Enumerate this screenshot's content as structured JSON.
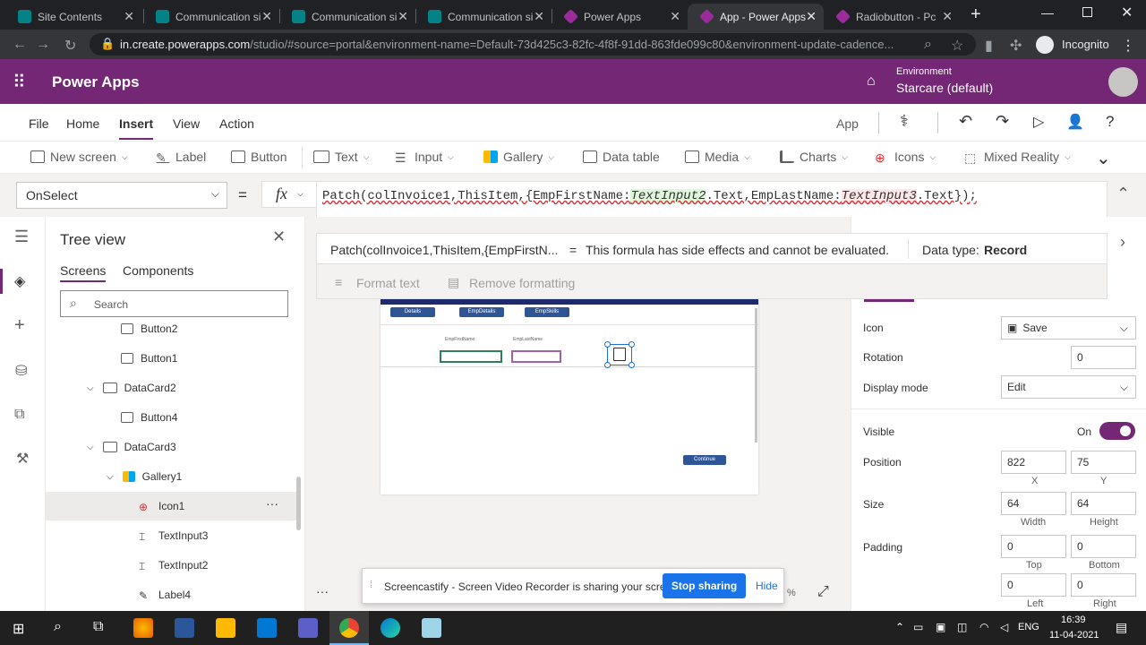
{
  "browser": {
    "tabs": [
      {
        "title": "Site Contents",
        "color": "#038387"
      },
      {
        "title": "Communication si",
        "color": "#038387"
      },
      {
        "title": "Communication si",
        "color": "#038387"
      },
      {
        "title": "Communication si",
        "color": "#038387"
      },
      {
        "title": "Power Apps",
        "color": "#9c2b9c"
      },
      {
        "title": "App - Power Apps",
        "color": "#9c2b9c"
      },
      {
        "title": "Radiobutton - Pc",
        "color": "#9c2b9c"
      }
    ],
    "url_host": "in.create.powerapps.com",
    "url_path": "/studio/#source=portal&environment-name=Default-73d425c3-82fc-4f8f-91dd-863fde099c80&environment-update-cadence...",
    "incognito_label": "Incognito"
  },
  "app": {
    "title": "Power Apps",
    "environment_label": "Environment",
    "environment_name": "Starcare (default)",
    "brand_color": "#742774"
  },
  "menu": {
    "items": [
      "File",
      "Home",
      "Insert",
      "View",
      "Action"
    ],
    "active": "Insert",
    "app_label": "App"
  },
  "ribbon": {
    "items": [
      "New screen",
      "Label",
      "Button",
      "Text",
      "Input",
      "Gallery",
      "Data table",
      "Media",
      "Charts",
      "Icons",
      "Mixed Reality"
    ]
  },
  "formula": {
    "property": "OnSelect",
    "equals": "=",
    "fx": "fx",
    "parts": [
      "Patch(colInvoice1,ThisItem,{EmpFirstName:",
      "TextInput2",
      ".Text,EmpLastName:",
      "TextInput3",
      ".Text});"
    ],
    "preview": "Patch(colInvoice1,ThisItem,{EmpFirstN...",
    "message": "This formula has side effects and cannot be evaluated.",
    "datatype_label": "Data type:",
    "datatype_value": "Record",
    "format_text": "Format text",
    "remove_formatting": "Remove formatting"
  },
  "tree": {
    "title": "Tree view",
    "tabs": [
      "Screens",
      "Components"
    ],
    "search_placeholder": "Search",
    "nodes": [
      {
        "label": "Button2",
        "indent": 0
      },
      {
        "label": "Button1",
        "indent": 0
      },
      {
        "label": "DataCard2",
        "indent": 1
      },
      {
        "label": "Button4",
        "indent": 0
      },
      {
        "label": "DataCard3",
        "indent": 1
      },
      {
        "label": "Gallery1",
        "indent": 2
      },
      {
        "label": "Icon1",
        "indent": 3
      },
      {
        "label": "TextInput3",
        "indent": 3
      },
      {
        "label": "TextInput2",
        "indent": 3
      },
      {
        "label": "Label4",
        "indent": 3
      }
    ],
    "more": "···"
  },
  "canvas": {
    "buttons": [
      "Details",
      "EmpDetails",
      "EmpSkills"
    ],
    "field_labels": [
      "EmpFirstName",
      "EmpLastName"
    ],
    "continue_label": "Continue"
  },
  "screencastify": {
    "message": "Screencastify - Screen Video Recorder is sharing your screen.",
    "stop": "Stop sharing",
    "hide": "Hide"
  },
  "zoom_suffix": "%",
  "props": {
    "icon_label": "Icon",
    "icon_value": "Save",
    "rotation_label": "Rotation",
    "rotation_value": "0",
    "display_mode_label": "Display mode",
    "display_mode_value": "Edit",
    "visible_label": "Visible",
    "visible_value": "On",
    "position_label": "Position",
    "x": "822",
    "y": "75",
    "x_caption": "X",
    "y_caption": "Y",
    "size_label": "Size",
    "width": "64",
    "height": "64",
    "width_caption": "Width",
    "height_caption": "Height",
    "padding_label": "Padding",
    "pad_top": "0",
    "pad_bottom": "0",
    "pad_left": "0",
    "pad_right": "0",
    "top_caption": "Top",
    "bottom_caption": "Bottom",
    "left_caption": "Left",
    "right_caption": "Right"
  },
  "taskbar": {
    "lang": "ENG",
    "time": "16:39",
    "date": "11-04-2021"
  }
}
